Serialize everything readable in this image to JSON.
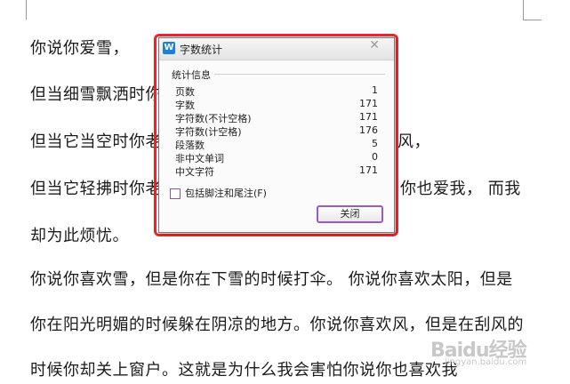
{
  "document": {
    "lines": [
      "你说你爱雪，",
      "但当细雪飘洒时你",
      "但当它当空时你老",
      "但当它轻拂时你老",
      "却为此烦忧。",
      "你说你喜欢雪，但是你在下雪的时候打伞。 你说你喜欢太阳，但是",
      "你在阳光明媚的时候躲在阴凉的地方。你说你喜欢风，但是在刮风的",
      "时候你却关上窗户。这就是为什么我会害怕你说你也喜欢我"
    ],
    "line3_tail": "风，",
    "line4_tail": "你也爱我， 而我"
  },
  "dialog": {
    "title": "字数统计",
    "app_icon_glyph": "W",
    "close_glyph": "✕",
    "group_label": "统计信息",
    "stats": [
      {
        "label": "页数",
        "value": "1"
      },
      {
        "label": "字数",
        "value": "171"
      },
      {
        "label": "字符数(不计空格)",
        "value": "171"
      },
      {
        "label": "字符数(计空格)",
        "value": "176"
      },
      {
        "label": "段落数",
        "value": "5"
      },
      {
        "label": "非中文单词",
        "value": "0"
      },
      {
        "label": "中文字符",
        "value": "171"
      }
    ],
    "checkbox_label": "包括脚注和尾注(F)",
    "checkbox_checked": false,
    "close_button": "关闭"
  },
  "watermark": {
    "main": "Baidu经验",
    "sub": "jingyan.baidu.com"
  },
  "colors": {
    "highlight_outline": "#e8262a",
    "button_border": "#9b5cc0",
    "app_icon": "#1e7fd6"
  }
}
